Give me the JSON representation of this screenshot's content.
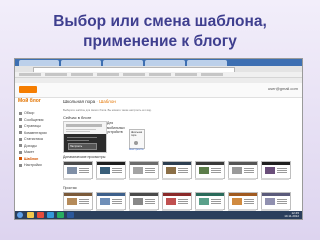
{
  "slide": {
    "title_line1": "Выбор или смена шаблона,",
    "title_line2": "применение к блогу"
  },
  "blogger": {
    "blog_name": "Мой блог",
    "breadcrumb_part1": "Школьная пора",
    "breadcrumb_separator": "·",
    "breadcrumb_part2": "Шаблон",
    "save_button_label": "Сохранить шаблон",
    "account_label": "user@gmail.com",
    "sidebar_items": [
      {
        "label": "Обзор",
        "icon": "overview-icon",
        "active": false
      },
      {
        "label": "Сообщения",
        "icon": "posts-icon",
        "active": false
      },
      {
        "label": "Страницы",
        "icon": "pages-icon",
        "active": false
      },
      {
        "label": "Комментарии",
        "icon": "comments-icon",
        "active": false
      },
      {
        "label": "Статистика",
        "icon": "stats-icon",
        "active": false
      },
      {
        "label": "Доходы",
        "icon": "earnings-icon",
        "active": false
      },
      {
        "label": "Макет",
        "icon": "layout-icon",
        "active": false
      },
      {
        "label": "Шаблон",
        "icon": "template-icon",
        "active": true
      },
      {
        "label": "Настройки",
        "icon": "settings-icon",
        "active": false
      }
    ],
    "intro_text": "Выберите шаблон для своего блога. Вы можете также настроить его вид.",
    "live_label": "Сейчас в блоге",
    "preview_config_label": "Настроить",
    "mobile_label": "Для мобильных устройств",
    "mobile_preview_caption": "Школьная пора",
    "mobile_link": "Настроить",
    "dynamic_section_label": "Динамические просмотры",
    "simple_section_label": "Простая",
    "dynamic_templates": [
      {
        "bar": "#4a4a4a",
        "img": "#7f8fa6"
      },
      {
        "bar": "#1f1f1f",
        "img": "#3a5f7a"
      },
      {
        "bar": "#6b6b6b",
        "img": "#a3a3a3"
      },
      {
        "bar": "#2d3e50",
        "img": "#8b6f47"
      },
      {
        "bar": "#3a3a3a",
        "img": "#5c7d4a"
      },
      {
        "bar": "#555555",
        "img": "#9a9a9a"
      },
      {
        "bar": "#202020",
        "img": "#6a4e7a"
      }
    ],
    "simple_templates": [
      {
        "bar": "#7a5a3a",
        "img": "#b58b5a"
      },
      {
        "bar": "#3d5f8a",
        "img": "#6f8fb8"
      },
      {
        "bar": "#4a4a4a",
        "img": "#888888"
      },
      {
        "bar": "#8a2a2a",
        "img": "#c05050"
      },
      {
        "bar": "#2a6a5a",
        "img": "#5aa08a"
      },
      {
        "bar": "#a05a20",
        "img": "#d08a40"
      },
      {
        "bar": "#5a5a7a",
        "img": "#9090b0"
      }
    ]
  },
  "taskbar": {
    "clock_time": "12:45",
    "clock_date": "10.11.2012",
    "icons": [
      {
        "name": "explorer-icon",
        "color": "#f2c94c"
      },
      {
        "name": "browser-icon",
        "color": "#e74c3c"
      },
      {
        "name": "media-icon",
        "color": "#3498db"
      },
      {
        "name": "chrome-icon",
        "color": "#27ae60"
      },
      {
        "name": "word-icon",
        "color": "#2b579a"
      }
    ]
  },
  "colors": {
    "accent": "#e06b00",
    "title": "#3f3f8f",
    "browser_tabs": "#3d6fb2"
  }
}
